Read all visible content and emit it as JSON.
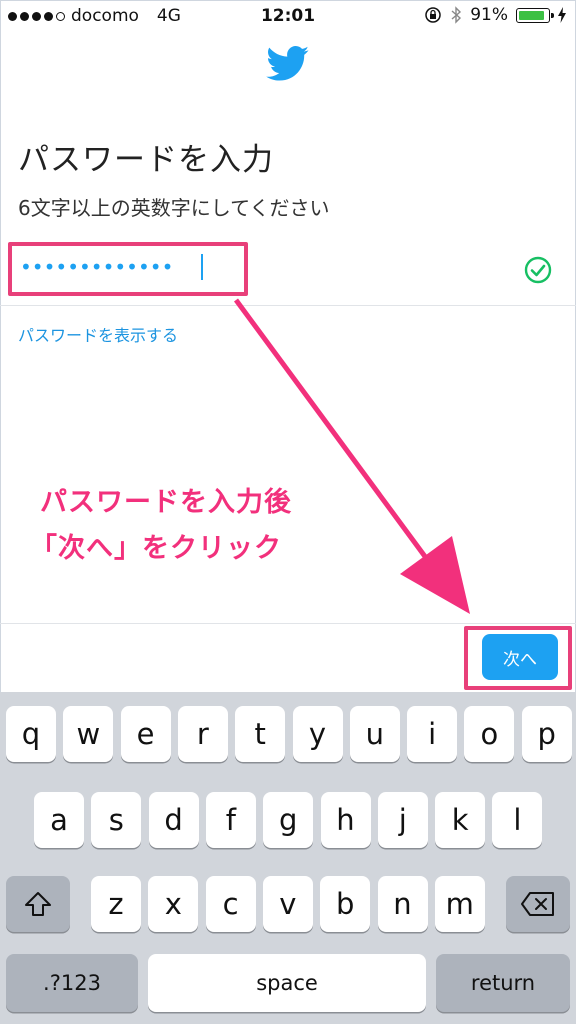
{
  "status_bar": {
    "carrier": "docomo",
    "network": "4G",
    "time": "12:01",
    "battery": "91%",
    "battery_level": 0.91,
    "battery_color": "#3cc043"
  },
  "logo_icon": "twitter-bird-icon",
  "brand_color": "#1da1f2",
  "page_title": "パスワードを入力",
  "subtitle": "6文字以上の英数字にしてください",
  "password_field": {
    "value": "•••••••••••••",
    "status_icon": "check-circle-icon"
  },
  "show_password_link": "パスワードを表示する",
  "annotation": {
    "line1": "パスワードを入力後",
    "line2": "「次へ」をクリック",
    "color": "#f2307c"
  },
  "next_button": "次へ",
  "keyboard": {
    "row1": [
      "q",
      "w",
      "e",
      "r",
      "t",
      "y",
      "u",
      "i",
      "o",
      "p"
    ],
    "row2": [
      "a",
      "s",
      "d",
      "f",
      "g",
      "h",
      "j",
      "k",
      "l"
    ],
    "row3": [
      "z",
      "x",
      "c",
      "v",
      "b",
      "n",
      "m"
    ],
    "shift_icon": "shift-icon",
    "delete_icon": "backspace-icon",
    "numbers_label": ".?123",
    "space_label": "space",
    "return_label": "return"
  }
}
